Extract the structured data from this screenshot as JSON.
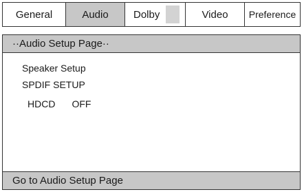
{
  "tabs": {
    "general": "General",
    "audio": "Audio",
    "dolby": "Dolby",
    "video": "Video",
    "preference": "Preference"
  },
  "panel": {
    "title": "··Audio Setup Page··",
    "footer": "Go to Audio Setup Page"
  },
  "menu": {
    "speaker_setup": "Speaker Setup",
    "spdif_setup": "SPDIF SETUP",
    "hdcd_label": "HDCD",
    "hdcd_value": "OFF"
  },
  "colors": {
    "selected_bg": "#c7c7c7",
    "border": "#333333"
  }
}
